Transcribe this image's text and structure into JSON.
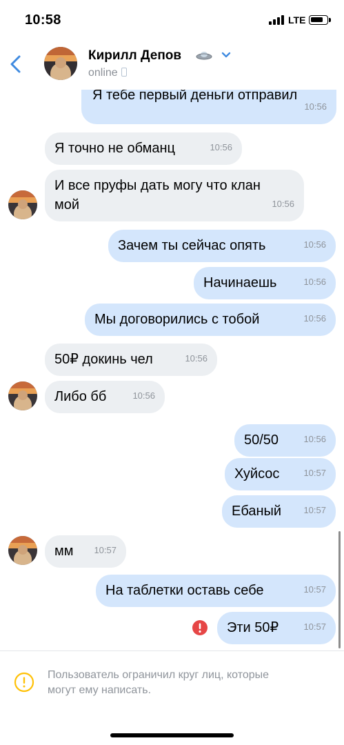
{
  "status_bar": {
    "time": "10:58",
    "network": "LTE"
  },
  "header": {
    "contact_name": "Кирилл Депов",
    "status": "online"
  },
  "messages": [
    {
      "text": "Я тебе первый деньги отправил",
      "time": "10:56"
    },
    {
      "text": "Я точно не обманц",
      "time": "10:56"
    },
    {
      "text": "И все пруфы дать могу что клан мой",
      "line1": "И все пруфы дать могу что клан",
      "line2": "мой",
      "time": "10:56"
    },
    {
      "text": "Зачем ты сейчас опять",
      "time": "10:56"
    },
    {
      "text": "Начинаешь",
      "time": "10:56"
    },
    {
      "text": "Мы договорились с тобой",
      "time": "10:56"
    },
    {
      "text": "50₽ докинь чел",
      "time": "10:56"
    },
    {
      "text": "Либо бб",
      "time": "10:56"
    },
    {
      "text": "50/50",
      "time": "10:56"
    },
    {
      "text": "Хуйсос",
      "time": "10:57"
    },
    {
      "text": "Ебаный",
      "time": "10:57"
    },
    {
      "text": "мм",
      "time": "10:57"
    },
    {
      "text": "На таблетки оставь себе",
      "time": "10:57"
    },
    {
      "text": "Эти 50₽",
      "time": "10:57"
    }
  ],
  "notice": {
    "line1": "Пользователь ограничил круг лиц, которые",
    "line2": "могут ему написать."
  },
  "colors": {
    "incoming_bubble": "#eceff2",
    "outgoing_bubble": "#d4e6fc",
    "accent": "#3f8ae0",
    "error": "#e64646",
    "warning": "#ffc107"
  },
  "icons": [
    "back-icon",
    "ufo-icon",
    "chevron-down-icon",
    "phone-icon",
    "error-icon",
    "warning-icon"
  ]
}
